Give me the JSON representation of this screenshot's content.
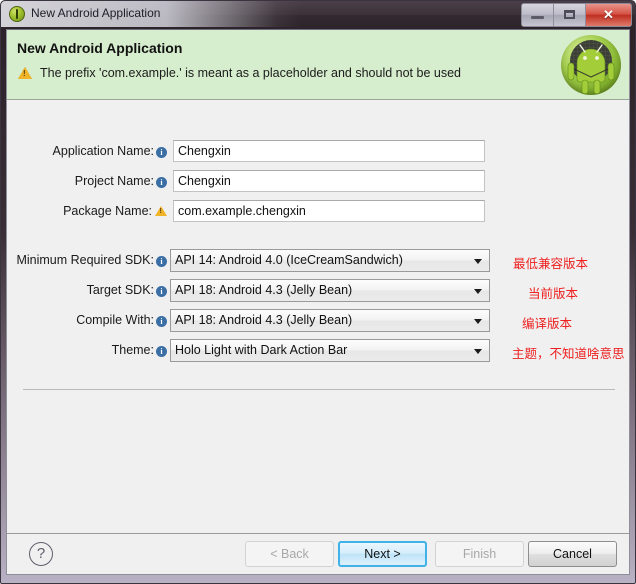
{
  "window": {
    "title": "New Android Application",
    "icon": "android-green-icon",
    "controls": {
      "minimize": "minimize-icon",
      "maximize": "maximize-icon",
      "close": "✕"
    }
  },
  "banner": {
    "title": "New Android Application",
    "message": "The prefix 'com.example.' is meant as a placeholder and should not be used",
    "message_icon": "warning-triangle-icon",
    "logo": "android-robot-icon",
    "background_color": "#d6eecd"
  },
  "form": {
    "text_fields": [
      {
        "label": "Application Name:",
        "icon": "info-icon",
        "value": "Chengxin"
      },
      {
        "label": "Project Name:",
        "icon": "info-icon",
        "value": "Chengxin"
      },
      {
        "label": "Package Name:",
        "icon": "warning-icon",
        "value": "com.example.chengxin"
      }
    ],
    "dropdowns": [
      {
        "label": "Minimum Required SDK:",
        "icon": "info-icon",
        "value": "API 14: Android 4.0 (IceCreamSandwich)",
        "note": "最低兼容版本"
      },
      {
        "label": "Target SDK:",
        "icon": "info-icon",
        "value": "API 18: Android 4.3 (Jelly Bean)",
        "note": "当前版本"
      },
      {
        "label": "Compile With:",
        "icon": "info-icon",
        "value": "API 18: Android 4.3 (Jelly Bean)",
        "note": "编译版本"
      },
      {
        "label": "Theme:",
        "icon": "info-icon",
        "value": "Holo Light with Dark Action Bar",
        "note": "主题，不知道啥意思"
      }
    ],
    "note_color": "#ee2020"
  },
  "footer": {
    "help": "?",
    "back": "< Back",
    "next": "Next >",
    "finish": "Finish",
    "cancel": "Cancel"
  }
}
